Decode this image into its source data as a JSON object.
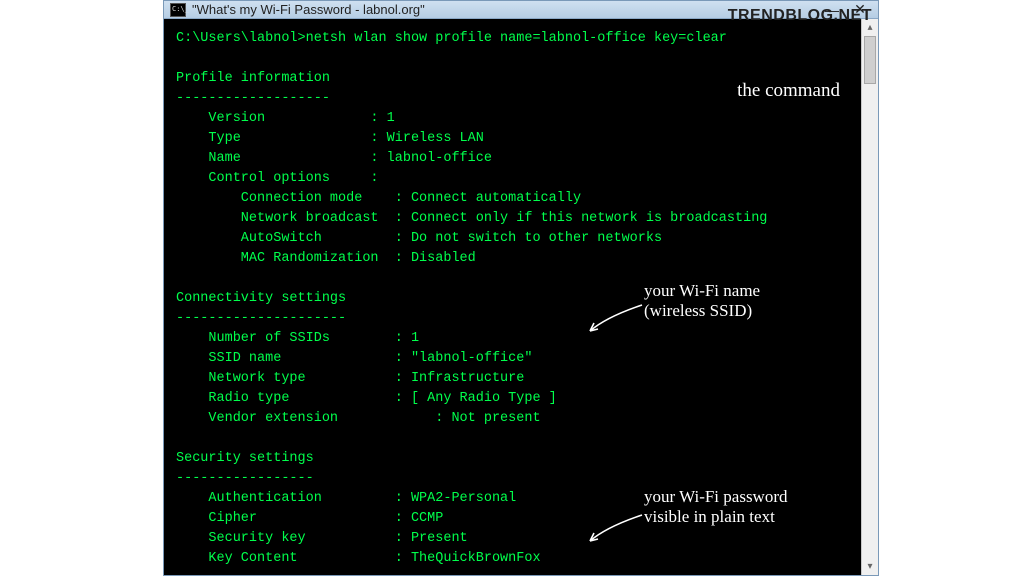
{
  "window": {
    "title": "\"What's my Wi-Fi Password - labnol.org\""
  },
  "watermark": "TRENDBLOG.NET",
  "term": {
    "prompt": "C:\\Users\\labnol>",
    "command": "netsh wlan show profile name=labnol-office key=clear",
    "sections": {
      "profile": {
        "heading": "Profile information",
        "rule": "-------------------",
        "rows": [
          {
            "k": "Version",
            "i1": 4,
            "col": 24,
            "v": "1"
          },
          {
            "k": "Type",
            "i1": 4,
            "col": 24,
            "v": "Wireless LAN"
          },
          {
            "k": "Name",
            "i1": 4,
            "col": 24,
            "v": "labnol-office"
          },
          {
            "k": "Control options",
            "i1": 4,
            "col": 24,
            "v": ""
          },
          {
            "k": "Connection mode",
            "i1": 8,
            "col": 27,
            "v": "Connect automatically"
          },
          {
            "k": "Network broadcast",
            "i1": 8,
            "col": 27,
            "v": "Connect only if this network is broadcasting"
          },
          {
            "k": "AutoSwitch",
            "i1": 8,
            "col": 27,
            "v": "Do not switch to other networks"
          },
          {
            "k": "MAC Randomization",
            "i1": 8,
            "col": 27,
            "v": "Disabled"
          }
        ]
      },
      "connectivity": {
        "heading": "Connectivity settings",
        "rule": "---------------------",
        "rows": [
          {
            "k": "Number of SSIDs",
            "i1": 4,
            "col": 27,
            "v": "1"
          },
          {
            "k": "SSID name",
            "i1": 4,
            "col": 27,
            "v": "\"labnol-office\""
          },
          {
            "k": "Network type",
            "i1": 4,
            "col": 27,
            "v": "Infrastructure"
          },
          {
            "k": "Radio type",
            "i1": 4,
            "col": 27,
            "v": "[ Any Radio Type ]"
          },
          {
            "k": "Vendor extension",
            "i1": 4,
            "col": 32,
            "v": "Not present"
          }
        ]
      },
      "security": {
        "heading": "Security settings",
        "rule": "-----------------",
        "rows": [
          {
            "k": "Authentication",
            "i1": 4,
            "col": 27,
            "v": "WPA2-Personal"
          },
          {
            "k": "Cipher",
            "i1": 4,
            "col": 27,
            "v": "CCMP"
          },
          {
            "k": "Security key",
            "i1": 4,
            "col": 27,
            "v": "Present"
          },
          {
            "k": "Key Content",
            "i1": 4,
            "col": 27,
            "v": "TheQuickBrownFox"
          }
        ]
      }
    }
  },
  "annotations": {
    "cmd": "the command",
    "ssid": "your Wi-Fi name\n(wireless SSID)",
    "pwd": "your Wi-Fi password\nvisible in plain text"
  }
}
